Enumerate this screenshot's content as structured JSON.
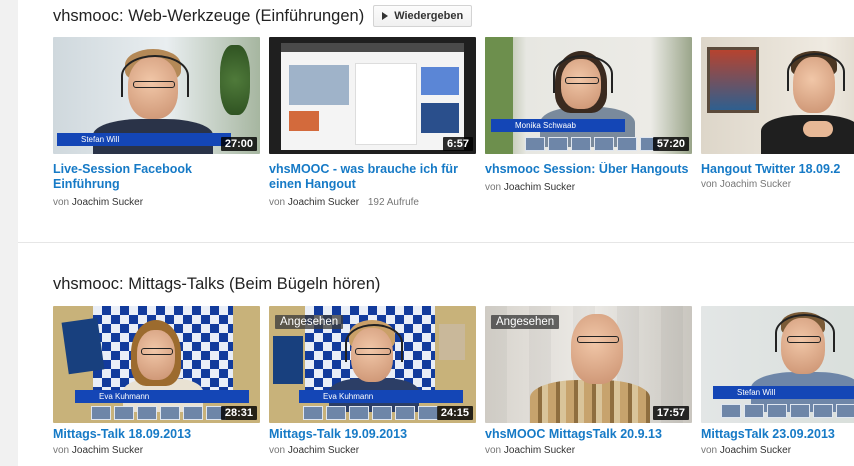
{
  "shelves": [
    {
      "title": "vhsmooc: Web-Werkzeuge (Einführungen)",
      "play_label": "Wiedergeben",
      "videos": [
        {
          "title": "Live-Session Facebook Einführung",
          "duration": "27:00",
          "by": "von",
          "author": "Joachim Sucker",
          "views": "",
          "watched": "",
          "overlay": "Stefan Will"
        },
        {
          "title": "vhsMOOC - was brauche ich für einen Hangout",
          "duration": "6:57",
          "by": "von",
          "author": "Joachim Sucker",
          "views": "192 Aufrufe",
          "watched": "",
          "overlay": ""
        },
        {
          "title": "vhsmooc Session: Über Hangouts",
          "duration": "57:20",
          "by": "von",
          "author": "Joachim Sucker",
          "views": "",
          "watched": "",
          "overlay": "Monika Schwaab"
        },
        {
          "title": "Hangout Twitter 18.09.2",
          "duration": "",
          "by": "von",
          "author": "Joachim Sucker",
          "views": "",
          "watched": "",
          "overlay": ""
        }
      ]
    },
    {
      "title": "vhsmooc: Mittags-Talks (Beim Bügeln hören)",
      "play_label": "",
      "videos": [
        {
          "title": "Mittags-Talk 18.09.2013",
          "duration": "28:31",
          "by": "von",
          "author": "Joachim Sucker",
          "views": "",
          "watched": "",
          "overlay": "Eva Kuhmann"
        },
        {
          "title": "Mittags-Talk 19.09.2013",
          "duration": "24:15",
          "by": "von",
          "author": "Joachim Sucker",
          "views": "",
          "watched": "Angesehen",
          "overlay": "Eva Kuhmann"
        },
        {
          "title": "vhsMOOC MittagsTalk 20.9.13",
          "duration": "17:57",
          "by": "von",
          "author": "Joachim Sucker",
          "views": "",
          "watched": "Angesehen",
          "overlay": ""
        },
        {
          "title": "MittagsTalk 23.09.2013",
          "duration": "",
          "by": "von",
          "author": "Joachim Sucker",
          "views": "",
          "watched": "",
          "overlay": "Stefan Will"
        }
      ]
    }
  ],
  "colors": {
    "link": "#167ac6",
    "meta": "#767676",
    "banner_blue": "#1446b6"
  },
  "icons": {
    "play": "play-icon"
  }
}
